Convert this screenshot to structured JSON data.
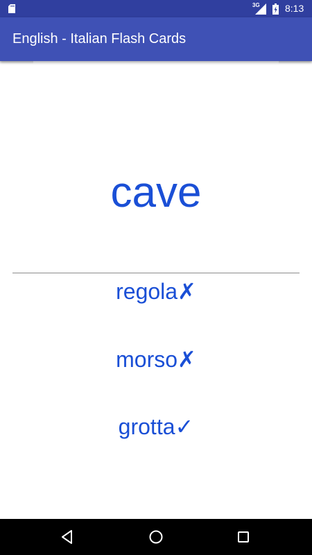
{
  "status_bar": {
    "network": "3G",
    "time": "8:13",
    "icons": [
      "sd-card-icon",
      "signal-icon",
      "battery-charging-icon"
    ]
  },
  "app_bar": {
    "title": "English - Italian Flash Cards"
  },
  "card": {
    "word": "cave",
    "options": [
      {
        "text": "regola",
        "mark": "✗",
        "result": "wrong"
      },
      {
        "text": "morso",
        "mark": "✗",
        "result": "wrong"
      },
      {
        "text": "grotta",
        "mark": "✓",
        "result": "correct"
      }
    ]
  },
  "nav_bar": {
    "buttons": [
      "back-icon",
      "home-icon",
      "recents-icon"
    ]
  },
  "colors": {
    "status_bar": "#303F9F",
    "app_bar": "#3F51B5",
    "word_text": "#1a4fd6",
    "nav_bar": "#000000",
    "background": "#ffffff"
  }
}
